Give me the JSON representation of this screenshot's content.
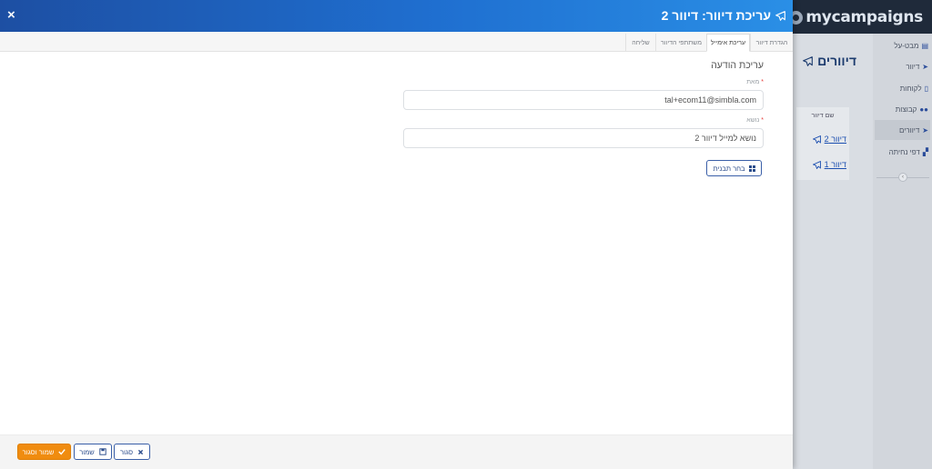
{
  "app": {
    "logo_text": "mycampaigns",
    "page_title": "דיוורים",
    "table_header": "שם דיוור",
    "rows": [
      "דיוור 2",
      "דיוור 1"
    ],
    "sidebar": [
      {
        "label": "מבט-על",
        "icon": "chart-icon"
      },
      {
        "label": "דיוור",
        "icon": "send-icon"
      },
      {
        "label": "לקוחות",
        "icon": "contacts-icon"
      },
      {
        "label": "קבוצות",
        "icon": "users-icon"
      },
      {
        "label": "דיוורים",
        "icon": "paper-plane-icon",
        "active": true
      },
      {
        "label": "דפי נחיתה",
        "icon": "landing-page-icon"
      }
    ]
  },
  "panel": {
    "title": "עריכת דיוור: דיוור 2",
    "close_symbol": "×",
    "tabs": [
      "הגדרת דיוור",
      "עריכת אימייל",
      "משתתפי הדיוור",
      "שליחה"
    ],
    "active_tab": 1,
    "section_title": "עריכת הודעה",
    "from_label": "מאת",
    "from_value": "tal+ecom11@simbla.com",
    "subject_label": "נושא",
    "subject_value": "נושא למייל דיוור 2",
    "required_mark": "*",
    "template_button": "בחר תבנית",
    "footer": {
      "save_close": "שמור וסגור",
      "save": "שמור",
      "close": "סגור"
    }
  },
  "colors": {
    "header_start": "#1d4fa3",
    "header_end": "#2a8fe6",
    "primary_button": "#f08c0f",
    "secondary_border": "#3a5fa8",
    "sidebar_bg": "#d2d6dc",
    "topbar_bg": "#1f2a3a"
  }
}
